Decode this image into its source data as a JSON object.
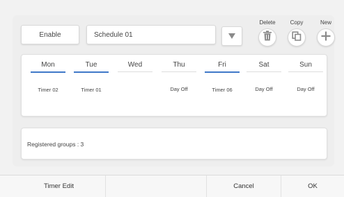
{
  "toolbar": {
    "enable_label": "Enable",
    "schedule_name": "Schedule 01",
    "dropdown_icon": "triangle-down-icon",
    "actions": {
      "delete_label": "Delete",
      "copy_label": "Copy",
      "new_label": "New"
    }
  },
  "week": {
    "days": [
      {
        "name": "Mon",
        "timer": "Timer 02",
        "active": true
      },
      {
        "name": "Tue",
        "timer": "Timer 01",
        "active": true
      },
      {
        "name": "Wed",
        "timer": "",
        "active": false
      },
      {
        "name": "Thu",
        "timer": "Day Off",
        "active": false
      },
      {
        "name": "Fri",
        "timer": "Timer 06",
        "active": true
      },
      {
        "name": "Sat",
        "timer": "Day Off",
        "active": false
      },
      {
        "name": "Sun",
        "timer": "Day Off",
        "active": false
      }
    ]
  },
  "groups": {
    "text": "Registered groups : 3"
  },
  "footer": {
    "timer_edit_label": "Timer Edit",
    "cancel_label": "Cancel",
    "ok_label": "OK"
  },
  "colors": {
    "accent": "#3f78c8",
    "icon": "#8a8a8a"
  }
}
